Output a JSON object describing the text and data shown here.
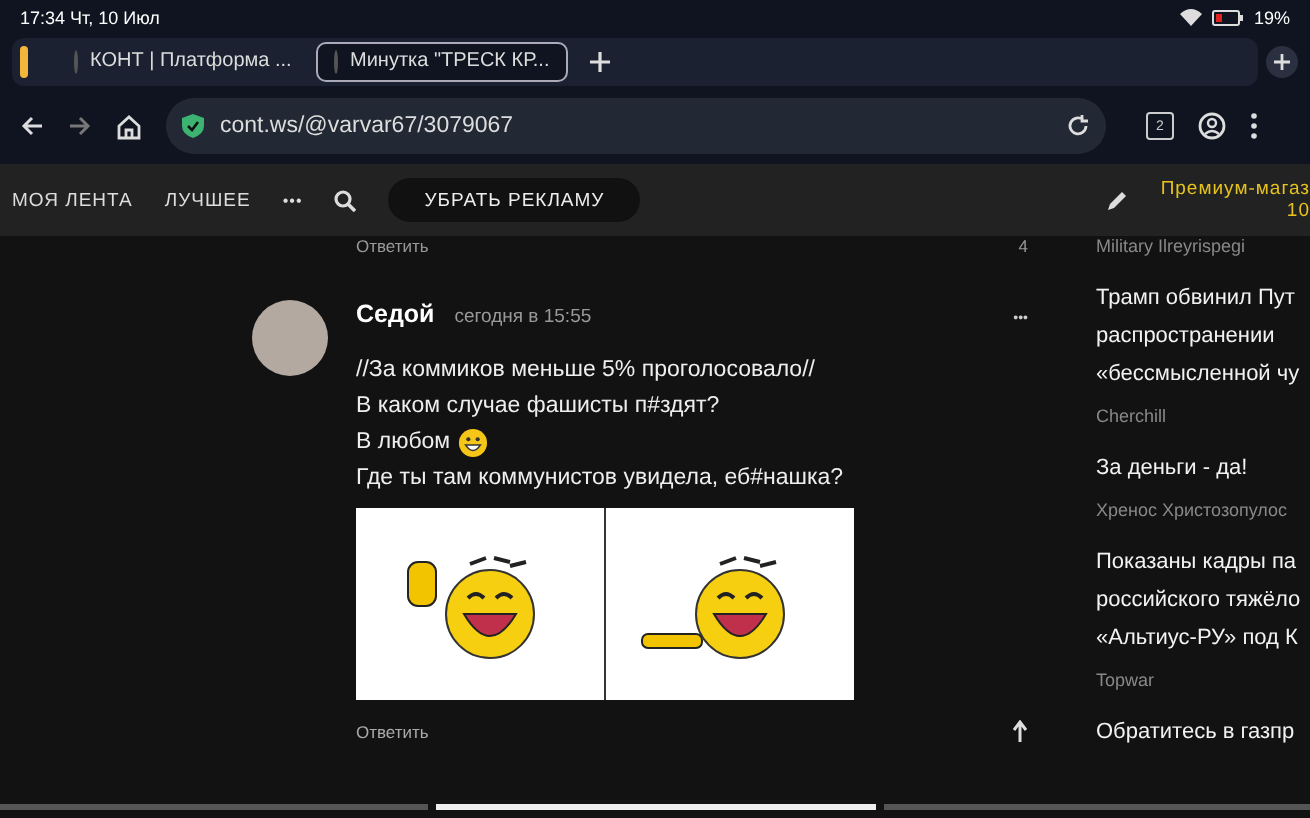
{
  "status_bar": {
    "time": "17:34 Чт, 10 Июл",
    "battery": "19%"
  },
  "browser_tabs": [
    {
      "title": "КОНТ | Платформа ...",
      "selected": false
    },
    {
      "title": "Минутка \"ТРЕСК КР...",
      "selected": true
    }
  ],
  "address_bar": {
    "url": "cont.ws/@varvar67/3079067",
    "tab_count": "2"
  },
  "site_nav": {
    "items": [
      "МОЯ ЛЕНТА",
      "ЛУЧШЕЕ"
    ],
    "more": "•••",
    "ad_button": "УБРАТЬ РЕКЛАМУ",
    "premium": "Премиум-магаз",
    "premium_sub": "10"
  },
  "prev_comment": {
    "reply": "Ответить",
    "votes": "4"
  },
  "comment": {
    "author": "Седой",
    "time": "сегодня в 15:55",
    "menu": "•••",
    "lines": [
      {
        "kind": "text",
        "text": "//За коммиков меньше 5% проголосовало//"
      },
      {
        "kind": "text",
        "text": "В каком случае фашисты п#здят?"
      },
      {
        "kind": "smiley",
        "text": "В любом"
      },
      {
        "kind": "text",
        "text": "Где ты там коммунистов увидела, еб#нашка?"
      }
    ],
    "reply": "Ответить"
  },
  "sidebar": {
    "top_author": "Military Ilreyrispegi",
    "articles": [
      {
        "lines": [
          "Трамп обвинил Пут",
          "распространении",
          "«бессмысленной чу"
        ],
        "author": "Cherchill"
      },
      {
        "lines": [
          "За деньги - да!"
        ],
        "author": "Хренос Христозопулос"
      },
      {
        "lines": [
          "Показаны кадры па",
          "российского тяжёло",
          "«Альтиус-РУ» под К"
        ],
        "author": "Topwar"
      },
      {
        "lines": [
          "Обратитесь в газпр"
        ]
      }
    ]
  }
}
